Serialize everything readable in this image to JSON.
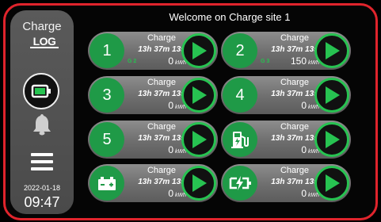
{
  "sidebar": {
    "brand_top": "Charge",
    "brand_logo": "LOG",
    "battery_icon": "battery-icon",
    "bell_icon": "bell-icon",
    "menu_icon": "menu-icon",
    "date": "2022-01-18",
    "time": "09:47"
  },
  "header": {
    "title": "Welcome on Charge site 1"
  },
  "colors": {
    "accent": "#27c351",
    "frame": "#e0242c",
    "circle": "#1f9a47"
  },
  "chargers": [
    {
      "id": "1",
      "label": "Charge",
      "duration": "13h 37m 13s",
      "value": "0",
      "unit": "kWh",
      "gun": "G 2",
      "icon": ""
    },
    {
      "id": "2",
      "label": "Charge",
      "duration": "13h 37m 13s",
      "value": "150",
      "unit": "kWh",
      "gun": "G 3",
      "icon": ""
    },
    {
      "id": "3",
      "label": "Charge",
      "duration": "13h 37m 13s",
      "value": "0",
      "unit": "kWh",
      "gun": "",
      "icon": ""
    },
    {
      "id": "4",
      "label": "Charge",
      "duration": "13h 37m 13s",
      "value": "0",
      "unit": "kWh",
      "gun": "",
      "icon": ""
    },
    {
      "id": "5",
      "label": "Charge",
      "duration": "13h 37m 13s",
      "value": "0",
      "unit": "kWh",
      "gun": "",
      "icon": ""
    },
    {
      "id": "",
      "label": "Charge",
      "duration": "13h 37m 13s",
      "value": "0",
      "unit": "kWh",
      "gun": "",
      "icon": "fuel-pump-icon"
    },
    {
      "id": "",
      "label": "Charge",
      "duration": "13h 37m 13s",
      "value": "0",
      "unit": "kWh",
      "gun": "",
      "icon": "car-battery-icon"
    },
    {
      "id": "",
      "label": "Charge",
      "duration": "13h 37m 13s",
      "value": "0",
      "unit": "kWh",
      "gun": "",
      "icon": "battery-bolt-icon"
    }
  ]
}
